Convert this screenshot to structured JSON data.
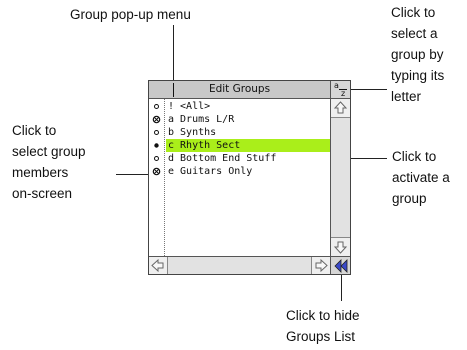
{
  "callouts": {
    "popup_menu": "Group pop-up menu",
    "select_by_letter": "Click to\nselect a\ngroup by\ntyping its\nletter",
    "select_members": "Click to\nselect group\nmembers\non-screen",
    "activate_group": "Click to\nactivate a\ngroup",
    "hide_list": "Click to hide\nGroups List"
  },
  "window": {
    "title": "Edit Groups",
    "az_top": "a",
    "az_bottom": "z",
    "groups": [
      {
        "marker": "hollow",
        "name": "! <All>"
      },
      {
        "marker": "crossed",
        "name": "a Drums L/R"
      },
      {
        "marker": "hollow",
        "name": "b Synths"
      },
      {
        "marker": "filled",
        "name": "c Rhyth Sect",
        "highlighted": true
      },
      {
        "marker": "hollow",
        "name": "d Bottom End Stuff"
      },
      {
        "marker": "crossed",
        "name": "e Guitars Only"
      }
    ]
  },
  "colors": {
    "highlight": "#aaee1a",
    "titlebar": "#c8c8c8"
  }
}
